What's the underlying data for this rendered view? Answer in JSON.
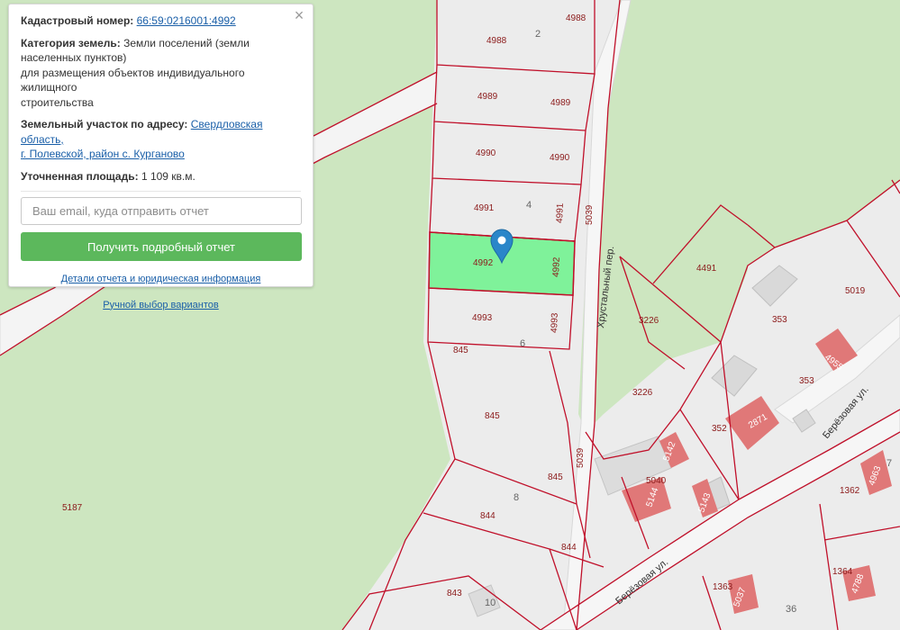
{
  "info_panel": {
    "close_symbol": "×",
    "cadastral_label": "Кадастровый номер:",
    "cadastral_number": "66:59:0216001:4992",
    "category_label": "Категория земель:",
    "category_line1": "Земли поселений (земли",
    "category_line2": "населенных пунктов)",
    "category_line3": "для размещения объектов индивидуального жилищного",
    "category_line4": "строительства",
    "address_label": "Земельный участок по адресу:",
    "address_line1": "Свердловская область,",
    "address_line2": "г. Полевской, район с. Курганово",
    "area_label": "Уточненная площадь:",
    "area_value": "1 109 кв.м.",
    "email_placeholder": "Ваш email, куда отправить отчет",
    "report_button": "Получить подробный отчет",
    "details_link": "Детали отчета и юридическая информация",
    "manual_link": "Ручной выбор вариантов"
  },
  "map": {
    "selected_plot": "4992",
    "plot_labels": {
      "p4988a": "4988",
      "p4988b": "4988",
      "p4989a": "4989",
      "p4989b": "4989",
      "p4990a": "4990",
      "p4990b": "4990",
      "p4991a": "4991",
      "p4991b": "4991",
      "p4992a": "4992",
      "p4992b": "4992",
      "p4993a": "4993",
      "p4993b": "4993",
      "p845a": "845",
      "p845b": "845",
      "p845c": "845",
      "p844a": "844",
      "p844b": "844",
      "p843": "843",
      "p5039a": "5039",
      "p5039b": "5039",
      "p5187": "5187",
      "p3226a": "3226",
      "p3226b": "3226",
      "p4491": "4491",
      "p5019": "5019",
      "p353a": "353",
      "p353b": "353",
      "p352": "352",
      "p1362": "1362",
      "p1363": "1363",
      "p1364": "1364",
      "p5040": "5040"
    },
    "house_labels": {
      "h4955": "4955",
      "h2871": "2871",
      "h5142": "5142",
      "h5144": "5144",
      "h5143": "5143",
      "h4963": "4963",
      "h5037": "5037",
      "h4788": "4788"
    },
    "block_labels": {
      "b2": "2",
      "b4": "4",
      "b6": "6",
      "b8": "8",
      "b10": "10",
      "b36": "36",
      "b7": "7"
    },
    "streets": {
      "khrustalny": "Хрустальный пер.",
      "berezovaya1": "Берёзовая ул.",
      "berezovaya2": "Берёзовая ул."
    },
    "colors": {
      "forest": "#cde6c0",
      "land": "#ececec",
      "boundary": "#c0102a",
      "selected": "#7ff29a",
      "house": "#e07878",
      "marker": "#2a86c9"
    }
  }
}
